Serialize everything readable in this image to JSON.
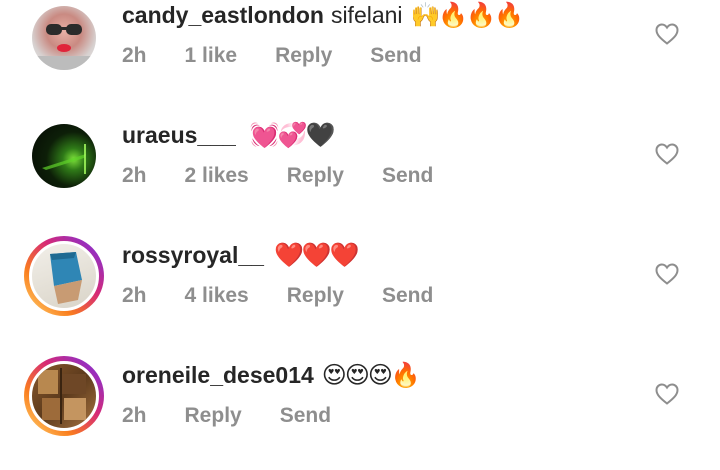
{
  "comments": [
    {
      "username": "candy_eastlondon",
      "text": "sifelani",
      "emojis": "🙌🔥🔥🔥",
      "time": "2h",
      "likes": "1 like",
      "reply": "Reply",
      "send": "Send",
      "avatar_ring": false
    },
    {
      "username": "uraeus___",
      "text": "",
      "emojis": "💓💞🖤",
      "time": "2h",
      "likes": "2 likes",
      "reply": "Reply",
      "send": "Send",
      "avatar_ring": false
    },
    {
      "username": "rossyroyal__",
      "text": "",
      "emojis": "❤️❤️❤️",
      "time": "2h",
      "likes": "4 likes",
      "reply": "Reply",
      "send": "Send",
      "avatar_ring": true
    },
    {
      "username": "oreneile_dese014",
      "text": "",
      "emojis": "😍😍😍🔥",
      "time": "2h",
      "likes": "",
      "reply": "Reply",
      "send": "Send",
      "avatar_ring": true
    }
  ],
  "colors": {
    "username": "#262626",
    "meta": "#8e8e8e",
    "heart_outline": "#8e8e8e"
  },
  "icons": {
    "like": "heart-outline-icon"
  }
}
